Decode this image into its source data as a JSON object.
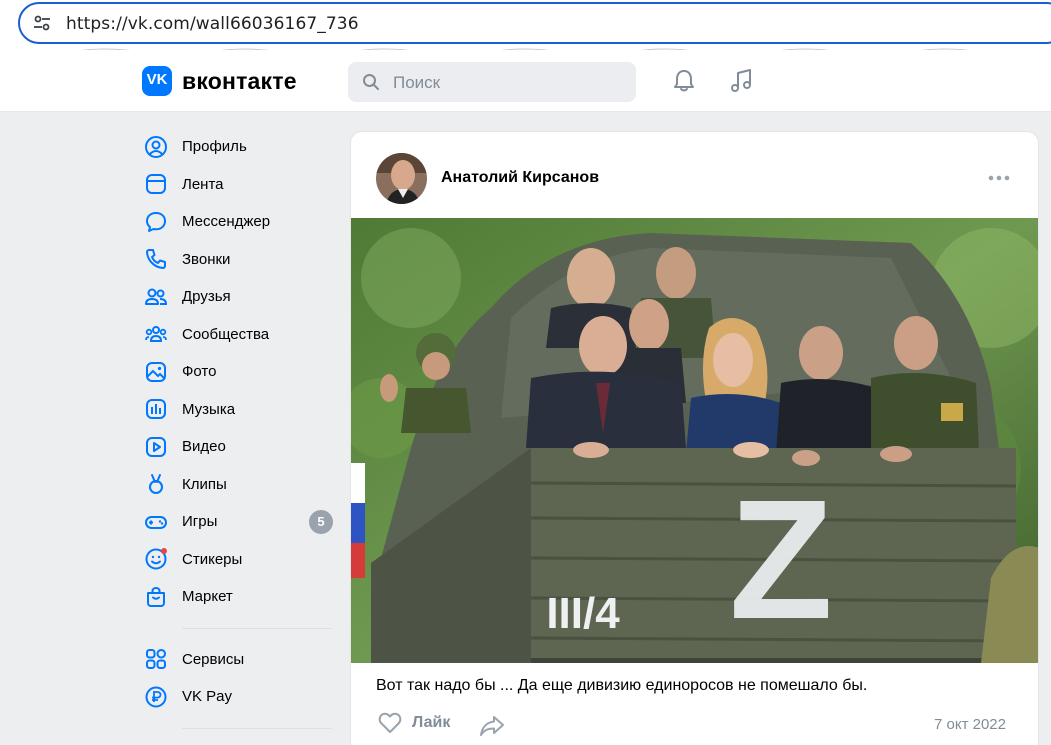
{
  "browser": {
    "url": "https://vk.com/wall66036167_736",
    "site_icon": "site-settings-icon"
  },
  "header": {
    "logo_mark": "VK",
    "logo_text": "вконтакте",
    "search_placeholder": "Поиск",
    "notifications_icon": "bell-icon",
    "music_icon": "music-note-icon",
    "brand_color": "#0077ff"
  },
  "sidebar": {
    "items": [
      {
        "label": "Профиль",
        "icon": "profile-icon"
      },
      {
        "label": "Лента",
        "icon": "feed-icon"
      },
      {
        "label": "Мессенджер",
        "icon": "messenger-icon"
      },
      {
        "label": "Звонки",
        "icon": "phone-icon"
      },
      {
        "label": "Друзья",
        "icon": "friends-icon"
      },
      {
        "label": "Сообщества",
        "icon": "communities-icon"
      },
      {
        "label": "Фото",
        "icon": "photo-icon"
      },
      {
        "label": "Музыка",
        "icon": "music-icon"
      },
      {
        "label": "Видео",
        "icon": "video-icon"
      },
      {
        "label": "Клипы",
        "icon": "clips-icon"
      },
      {
        "label": "Игры",
        "icon": "gamepad-icon",
        "badge": "5"
      },
      {
        "label": "Стикеры",
        "icon": "stickers-icon"
      },
      {
        "label": "Маркет",
        "icon": "market-icon"
      }
    ],
    "extra_items": [
      {
        "label": "Сервисы",
        "icon": "services-icon"
      },
      {
        "label": "VK Pay",
        "icon": "vkpay-icon"
      }
    ]
  },
  "post": {
    "author": "Анатолий Кирсанов",
    "more_icon": "more-dots-icon",
    "image_marking": "Z",
    "image_plate": "III/4",
    "caption": "Вот так надо бы ... Да еще дивизию единоросов не помешало бы.",
    "like_label": "Лайк",
    "date": "7 окт 2022"
  }
}
